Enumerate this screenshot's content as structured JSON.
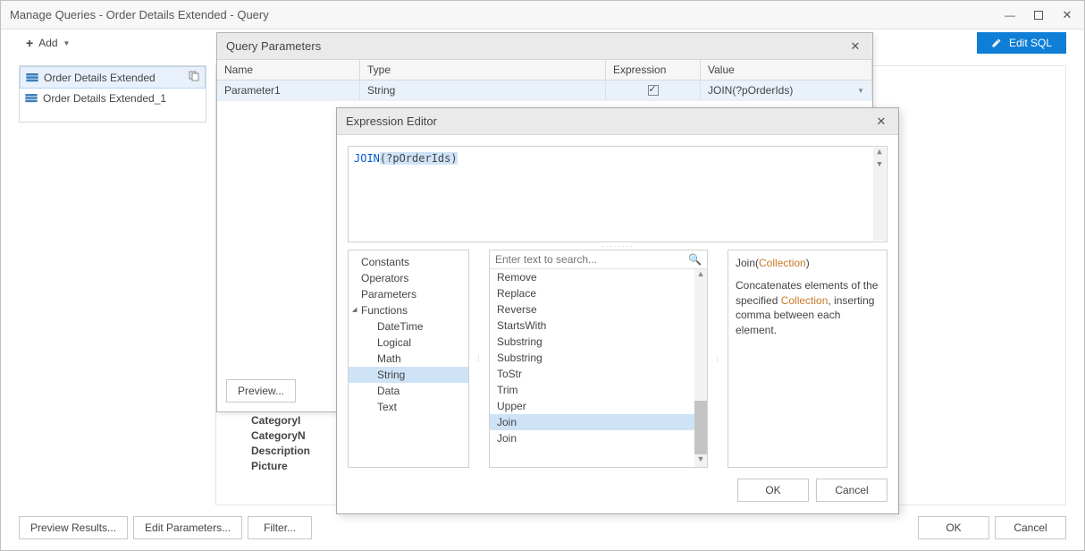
{
  "window": {
    "title": "Manage Queries - Order Details Extended - Query"
  },
  "toolbar": {
    "add_label": "Add",
    "edit_sql_label": "Edit SQL"
  },
  "queries": {
    "items": [
      {
        "label": "Order Details Extended"
      },
      {
        "label": "Order Details Extended_1"
      }
    ]
  },
  "back_fields": [
    "CategoryI",
    "CategoryN",
    "Description",
    "Picture"
  ],
  "main_buttons": {
    "preview_results": "Preview Results...",
    "edit_parameters": "Edit Parameters...",
    "filter": "Filter...",
    "ok": "OK",
    "cancel": "Cancel"
  },
  "qparams": {
    "title": "Query Parameters",
    "headers": {
      "name": "Name",
      "type": "Type",
      "expression": "Expression",
      "value": "Value"
    },
    "row": {
      "name": "Parameter1",
      "type": "String",
      "value": "JOIN(?pOrderIds)"
    },
    "buttons": {
      "preview": "Preview..."
    }
  },
  "expr": {
    "title": "Expression Editor",
    "expr_kw": "JOIN",
    "expr_args": "(?pOrderIds)",
    "tree": {
      "constants": "Constants",
      "operators": "Operators",
      "parameters": "Parameters",
      "functions": "Functions",
      "datetime": "DateTime",
      "logical": "Logical",
      "math": "Math",
      "string": "String",
      "data": "Data",
      "text": "Text"
    },
    "search_placeholder": "Enter text to search...",
    "fn_items": [
      "Remove",
      "Replace",
      "Reverse",
      "StartsWith",
      "Substring",
      "Substring",
      "ToStr",
      "Trim",
      "Upper",
      "Join",
      "Join"
    ],
    "help_sig_pre": "Join(",
    "help_sig_hl": "Collection",
    "help_sig_post": ")",
    "help_body_1": "Concatenates elements of the specified ",
    "help_body_hl": "Collection",
    "help_body_2": ", inserting comma between each element.",
    "ok": "OK",
    "cancel": "Cancel"
  }
}
